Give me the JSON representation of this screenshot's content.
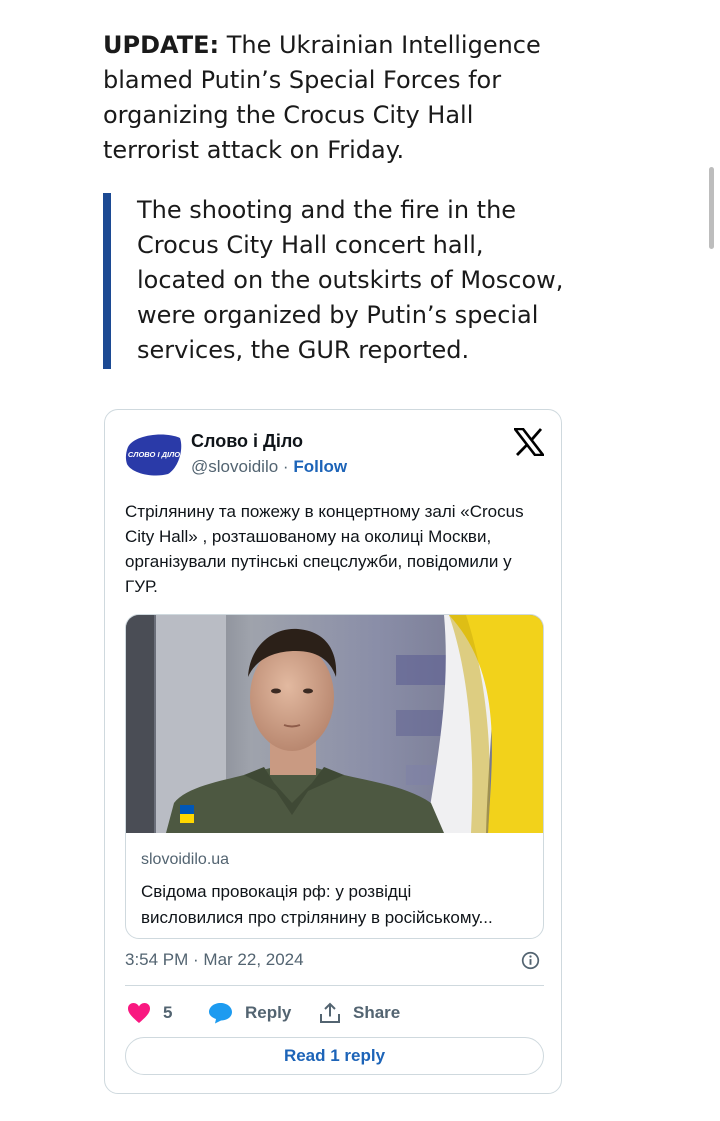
{
  "article": {
    "update_label": "UPDATE:",
    "update_text": "The Ukrainian Intelligence blamed Putin’s Special Forces for organizing the Crocus City Hall terrorist attack on Friday.",
    "quote_text": "The shooting and the fire in the Crocus City Hall concert hall, located on the outskirts of Moscow, were organized by Putin’s special services, the GUR reported."
  },
  "tweet": {
    "author_name": "Слово і Діло",
    "avatar_text": "СЛОВО І ДІЛО",
    "handle": "@slovoidilo",
    "separator": "·",
    "follow_label": "Follow",
    "text": "Стрілянину та пожежу в концертному залі «Crocus City Hall» , розташованому на околиці Москви, організували путінські спецслужби, повідомили у ГУР.",
    "card": {
      "domain": "slovoidilo.ua",
      "title_line1": "Свідома провокація рф: у розвідці",
      "title_line2": "висловилися про стрілянину в російському..."
    },
    "timestamp": "3:54 PM · Mar 22, 2024",
    "like_count": "5",
    "reply_label": "Reply",
    "share_label": "Share",
    "read_replies_label": "Read 1 reply"
  },
  "colors": {
    "quote_bar": "#1c4a93",
    "link_blue": "#1d64b8",
    "like_red": "#f91880",
    "reply_blue": "#1d9bf0",
    "flag_blue": "#0057b7",
    "flag_yellow": "#ffd700"
  },
  "icons": [
    "avatar-logo",
    "x-logo-icon",
    "info-icon",
    "heart-icon",
    "reply-bubble-icon",
    "share-icon"
  ]
}
